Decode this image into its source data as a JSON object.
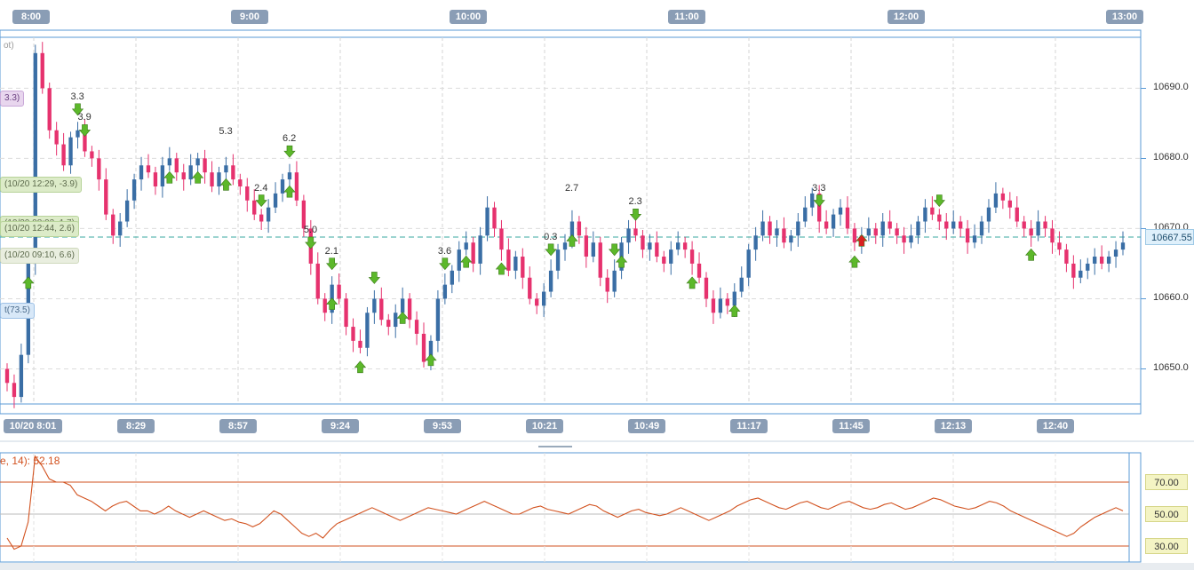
{
  "colors": {
    "up_candle": "#3a6ea5",
    "down_candle": "#e6326e",
    "buy_arrow": "#5cb82a",
    "sell_arrow": "#d92020",
    "rsi_line": "#d2521f",
    "grid": "#d8d8d8",
    "axis": "#5a9ad6"
  },
  "top_time_labels": [
    "8:00",
    "9:00",
    "10:00",
    "11:00",
    "12:00",
    "13:00"
  ],
  "bottom_time_labels": [
    "10/20  8:01",
    "8:29",
    "8:57",
    "9:24",
    "9:53",
    "10:21",
    "10:49",
    "11:17",
    "11:45",
    "12:13",
    "12:40"
  ],
  "price_axis": {
    "labels": [
      "10690.0",
      "10680.0",
      "10670.0",
      "10660.0",
      "10650.0"
    ],
    "current_price": "10667.55"
  },
  "annotations": {
    "top_left_partial": "ot)",
    "purple_box": "3.3)",
    "green_1": "(10/20 12:29, -3.9)",
    "green_2": "(10/20 08:02, 1.7)",
    "green_3": "(10/20 12:44, 2.6)",
    "green_4": "(10/20 09:10, 6.6)",
    "blue_box": "t(73.5)"
  },
  "signal_values": [
    "3.3",
    "3.9",
    "2.4",
    "5.0",
    "6.2",
    "2.1",
    "5.3",
    "3.6",
    "0.3",
    "2.7",
    "2.3",
    "3.3"
  ],
  "rsi": {
    "title": "e, 14): 52.18",
    "levels": [
      "70.00",
      "50.00",
      "30.00"
    ]
  },
  "chart_data": {
    "type": "candlestick",
    "ylim": [
      10645,
      10697
    ],
    "current_price": 10667.55,
    "closes": [
      10648,
      10646,
      10652,
      10665,
      10695,
      10690,
      10684,
      10682,
      10679,
      10683,
      10684,
      10681,
      10680,
      10677,
      10672,
      10669,
      10671,
      10674,
      10677,
      10679,
      10678,
      10676,
      10679,
      10680,
      10678,
      10677,
      10679,
      10680,
      10678,
      10676,
      10678,
      10679,
      10677,
      10676,
      10674,
      10672,
      10671,
      10673,
      10675,
      10677,
      10678,
      10674,
      10670,
      10665,
      10660,
      10658,
      10662,
      10660,
      10656,
      10654,
      10653,
      10658,
      10660,
      10657,
      10656,
      10658,
      10660,
      10657,
      10655,
      10651,
      10654,
      10660,
      10662,
      10664,
      10667,
      10668,
      10665,
      10669,
      10673,
      10670,
      10667,
      10664,
      10666,
      10663,
      10660,
      10659,
      10661,
      10664,
      10667,
      10668,
      10671,
      10669,
      10666,
      10668,
      10663,
      10661,
      10664,
      10668,
      10670,
      10669,
      10667,
      10668,
      10666,
      10665,
      10667,
      10668,
      10667,
      10665,
      10663,
      10660,
      10658,
      10660,
      10659,
      10661,
      10663,
      10667,
      10669,
      10671,
      10669,
      10670,
      10668,
      10669,
      10671,
      10673,
      10675,
      10671,
      10670,
      10672,
      10673,
      10670,
      10668,
      10669,
      10670,
      10669,
      10671,
      10670,
      10669,
      10668,
      10669,
      10671,
      10673,
      10672,
      10671,
      10670,
      10671,
      10670,
      10668,
      10669,
      10671,
      10673,
      10675,
      10674,
      10673,
      10671,
      10670,
      10669,
      10671,
      10670,
      10668,
      10667,
      10665,
      10663,
      10664,
      10665,
      10666,
      10665,
      10666,
      10667,
      10668
    ],
    "buy_signals": [
      3,
      23,
      27,
      31,
      40,
      46,
      50,
      56,
      60,
      65,
      70,
      80,
      87,
      97,
      103,
      120,
      145
    ],
    "sell_signals": [
      10,
      11,
      36,
      40,
      43,
      46,
      52,
      62,
      77,
      86,
      89,
      115,
      132
    ],
    "signal_labels": [
      {
        "index": 10,
        "value": "3.3"
      },
      {
        "index": 11,
        "value": "3.9"
      },
      {
        "index": 36,
        "value": "2.4"
      },
      {
        "index": 43,
        "value": "5.0"
      },
      {
        "index": 40,
        "value": "6.2"
      },
      {
        "index": 46,
        "value": "2.1"
      },
      {
        "index": 31,
        "value": "5.3"
      },
      {
        "index": 62,
        "value": "3.6"
      },
      {
        "index": 77,
        "value": "0.3"
      },
      {
        "index": 80,
        "value": "2.7"
      },
      {
        "index": 89,
        "value": "2.3"
      },
      {
        "index": 115,
        "value": "3.3"
      }
    ],
    "rsi_values": [
      35,
      28,
      30,
      45,
      92,
      80,
      72,
      70,
      70,
      68,
      62,
      60,
      58,
      55,
      52,
      55,
      57,
      58,
      55,
      52,
      52,
      50,
      52,
      55,
      52,
      50,
      48,
      50,
      52,
      50,
      48,
      46,
      47,
      45,
      44,
      42,
      44,
      48,
      52,
      50,
      46,
      42,
      38,
      36,
      38,
      35,
      40,
      44,
      46,
      48,
      50,
      52,
      54,
      52,
      50,
      48,
      46,
      48,
      50,
      52,
      54,
      53,
      52,
      51,
      50,
      52,
      54,
      56,
      58,
      56,
      54,
      52,
      50,
      50,
      52,
      54,
      55,
      53,
      52,
      51,
      50,
      52,
      54,
      56,
      55,
      52,
      50,
      48,
      50,
      52,
      53,
      51,
      50,
      49,
      50,
      52,
      54,
      52,
      50,
      48,
      46,
      48,
      50,
      52,
      55,
      57,
      59,
      60,
      58,
      56,
      54,
      53,
      55,
      57,
      58,
      56,
      54,
      53,
      55,
      57,
      58,
      56,
      54,
      53,
      54,
      56,
      57,
      55,
      53,
      54,
      56,
      58,
      60,
      59,
      57,
      55,
      54,
      53,
      54,
      56,
      58,
      57,
      55,
      52,
      50,
      48,
      46,
      44,
      42,
      40,
      38,
      36,
      38,
      42,
      45,
      48,
      50,
      52,
      54,
      52
    ]
  }
}
